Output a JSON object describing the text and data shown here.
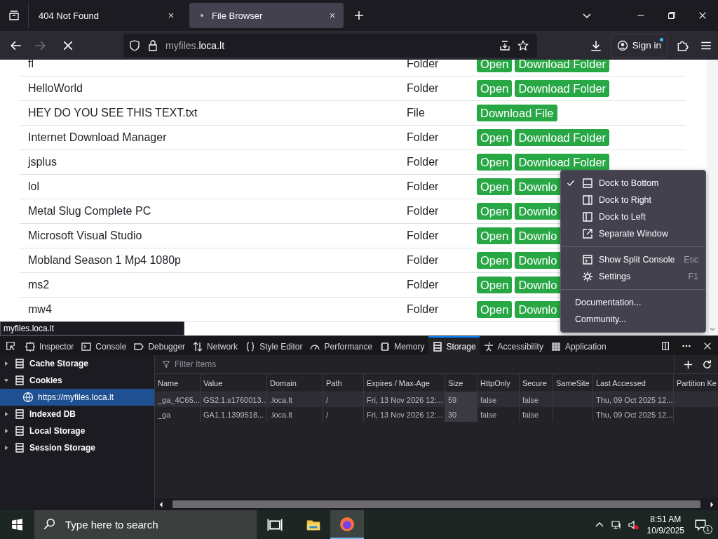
{
  "browser_tabs": [
    {
      "label": "404 Not Found",
      "selected": false
    },
    {
      "label": "File Browser",
      "selected": true
    }
  ],
  "nav": {
    "back_disabled": false,
    "forward_disabled": true
  },
  "address": {
    "subdomain": "myfiles.",
    "domain": "loca.lt"
  },
  "sign_in": "Sign in",
  "files": [
    {
      "name": "fl",
      "type": "Folder",
      "buttons": [
        "Open",
        "Download Folder"
      ]
    },
    {
      "name": "HelloWorld",
      "type": "Folder",
      "buttons": [
        "Open",
        "Download Folder"
      ]
    },
    {
      "name": "HEY DO YOU SEE THIS TEXT.txt",
      "type": "File",
      "buttons": [
        "Download File"
      ]
    },
    {
      "name": "Internet Download Manager",
      "type": "Folder",
      "buttons": [
        "Open",
        "Download Folder"
      ]
    },
    {
      "name": "jsplus",
      "type": "Folder",
      "buttons": [
        "Open",
        "Download Folder"
      ]
    },
    {
      "name": "lol",
      "type": "Folder",
      "buttons": [
        "Open",
        "Downlo"
      ]
    },
    {
      "name": "Metal Slug Complete PC",
      "type": "Folder",
      "buttons": [
        "Open",
        "Downlo"
      ]
    },
    {
      "name": "Microsoft Visual Studio",
      "type": "Folder",
      "buttons": [
        "Open",
        "Downlo"
      ]
    },
    {
      "name": "Mobland Season 1 Mp4 1080p",
      "type": "Folder",
      "buttons": [
        "Open",
        "Downlo"
      ]
    },
    {
      "name": "ms2",
      "type": "Folder",
      "buttons": [
        "Open",
        "Downlo"
      ]
    },
    {
      "name": "mw4",
      "type": "Folder",
      "buttons": [
        "Open",
        "Downlo"
      ]
    }
  ],
  "status_tooltip": "myfiles.loca.lt",
  "menu": {
    "groups": [
      [
        {
          "label": "Dock to Bottom",
          "kind": "bottom",
          "checked": true
        },
        {
          "label": "Dock to Right",
          "kind": "right",
          "checked": false
        },
        {
          "label": "Dock to Left",
          "kind": "left",
          "checked": false
        },
        {
          "label": "Separate Window",
          "kind": "window",
          "checked": false
        }
      ],
      [
        {
          "label": "Show Split Console",
          "kind": "console",
          "shortcut": "Esc"
        },
        {
          "label": "Settings",
          "kind": "settings",
          "shortcut": "F1"
        }
      ],
      [
        {
          "label": "Documentation...",
          "kind": "link"
        },
        {
          "label": "Community...",
          "kind": "link"
        }
      ]
    ]
  },
  "devtools": {
    "tabs": [
      {
        "label": "Inspector",
        "selected": false
      },
      {
        "label": "Console",
        "selected": false
      },
      {
        "label": "Debugger",
        "selected": false
      },
      {
        "label": "Network",
        "selected": false
      },
      {
        "label": "Style Editor",
        "selected": false
      },
      {
        "label": "Performance",
        "selected": false
      },
      {
        "label": "Memory",
        "selected": false
      },
      {
        "label": "Storage",
        "selected": true
      },
      {
        "label": "Accessibility",
        "selected": false
      },
      {
        "label": "Application",
        "selected": false
      }
    ],
    "tree": [
      {
        "label": "Cache Storage",
        "expanded": false
      },
      {
        "label": "Cookies",
        "expanded": true,
        "children": [
          {
            "label": "https://myfiles.loca.lt",
            "selected": true
          }
        ]
      },
      {
        "label": "Indexed DB",
        "expanded": false
      },
      {
        "label": "Local Storage",
        "expanded": false
      },
      {
        "label": "Session Storage",
        "expanded": false
      }
    ],
    "filter_placeholder": "Filter Items",
    "columns": [
      "Name",
      "Value",
      "Domain",
      "Path",
      "Expires / Max-Age",
      "Size",
      "HttpOnly",
      "Secure",
      "SameSite",
      "Last Accessed",
      "Partition Ke"
    ],
    "rows": [
      {
        "name": "_ga_4C65...",
        "value": "GS2.1.s1760013...",
        "domain": ".loca.lt",
        "path": "/",
        "expires": "Fri, 13 Nov 2026 12:...",
        "size": "59",
        "http_only": "false",
        "secure": "false",
        "last_accessed": "Thu, 09 Oct 2025 12..."
      },
      {
        "name": "_ga",
        "value": "GA1.1.1399518...",
        "domain": ".loca.lt",
        "path": "/",
        "expires": "Fri, 13 Nov 2026 12:...",
        "size": "30",
        "http_only": "false",
        "secure": "false",
        "last_accessed": "Thu, 09 Oct 2025 12..."
      }
    ]
  },
  "taskbar": {
    "search_placeholder": "Type here to search",
    "time": "8:51 AM",
    "date": "10/9/2025",
    "notifications": "1"
  }
}
